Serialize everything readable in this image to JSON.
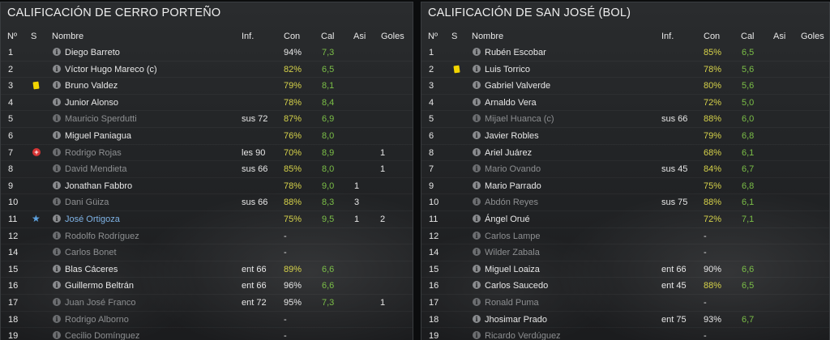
{
  "left": {
    "title": "CALIFICACIÓN DE CERRO PORTEÑO",
    "headers": {
      "num": "Nº",
      "s": "S",
      "name": "Nombre",
      "inf": "Inf.",
      "con": "Con",
      "cal": "Cal",
      "asi": "Asi",
      "goles": "Goles"
    },
    "rows": [
      {
        "num": "1",
        "status": "",
        "name": "Diego Barreto",
        "dim": false,
        "inf": "",
        "con": "94%",
        "cal": "7,3",
        "asi": "",
        "goles": "",
        "con_color": "white"
      },
      {
        "num": "2",
        "status": "",
        "name": "Víctor Hugo Mareco (c)",
        "dim": false,
        "inf": "",
        "con": "82%",
        "cal": "6,5",
        "asi": "",
        "goles": "",
        "con_color": "yellow"
      },
      {
        "num": "3",
        "status": "yellow-card",
        "name": "Bruno Valdez",
        "dim": false,
        "inf": "",
        "con": "79%",
        "cal": "8,1",
        "asi": "",
        "goles": "",
        "con_color": "yellow"
      },
      {
        "num": "4",
        "status": "",
        "name": "Junior Alonso",
        "dim": false,
        "inf": "",
        "con": "78%",
        "cal": "8,4",
        "asi": "",
        "goles": "",
        "con_color": "yellow"
      },
      {
        "num": "5",
        "status": "",
        "name": "Mauricio Sperdutti",
        "dim": true,
        "inf": "sus 72",
        "con": "87%",
        "cal": "6,9",
        "asi": "",
        "goles": "",
        "con_color": "yellow"
      },
      {
        "num": "6",
        "status": "",
        "name": "Miguel Paniagua",
        "dim": false,
        "inf": "",
        "con": "76%",
        "cal": "8,0",
        "asi": "",
        "goles": "",
        "con_color": "yellow"
      },
      {
        "num": "7",
        "status": "injury",
        "name": "Rodrigo Rojas",
        "dim": true,
        "inf": "les 90",
        "con": "70%",
        "cal": "8,9",
        "asi": "",
        "goles": "1",
        "con_color": "yellow"
      },
      {
        "num": "8",
        "status": "",
        "name": "David Mendieta",
        "dim": true,
        "inf": "sus 66",
        "con": "85%",
        "cal": "8,0",
        "asi": "",
        "goles": "1",
        "con_color": "yellow"
      },
      {
        "num": "9",
        "status": "",
        "name": "Jonathan Fabbro",
        "dim": false,
        "inf": "",
        "con": "78%",
        "cal": "9,0",
        "asi": "1",
        "goles": "",
        "con_color": "yellow"
      },
      {
        "num": "10",
        "status": "",
        "name": "Dani Güiza",
        "dim": true,
        "inf": "sus 66",
        "con": "88%",
        "cal": "8,3",
        "asi": "3",
        "goles": "",
        "con_color": "yellow"
      },
      {
        "num": "11",
        "status": "star",
        "name": "José Ortigoza",
        "dim": false,
        "selected": true,
        "inf": "",
        "con": "75%",
        "cal": "9,5",
        "asi": "1",
        "goles": "2",
        "con_color": "yellow"
      },
      {
        "num": "12",
        "status": "",
        "name": "Rodolfo Rodríguez",
        "dim": true,
        "inf": "",
        "con": "-",
        "cal": "",
        "asi": "",
        "goles": "",
        "con_color": "white"
      },
      {
        "num": "14",
        "status": "",
        "name": "Carlos Bonet",
        "dim": true,
        "inf": "",
        "con": "-",
        "cal": "",
        "asi": "",
        "goles": "",
        "con_color": "white"
      },
      {
        "num": "15",
        "status": "",
        "name": "Blas Cáceres",
        "dim": false,
        "inf": "ent 66",
        "con": "89%",
        "cal": "6,6",
        "asi": "",
        "goles": "",
        "con_color": "yellow"
      },
      {
        "num": "16",
        "status": "",
        "name": "Guillermo Beltrán",
        "dim": false,
        "inf": "ent 66",
        "con": "96%",
        "cal": "6,6",
        "asi": "",
        "goles": "",
        "con_color": "white"
      },
      {
        "num": "17",
        "status": "",
        "name": "Juan José Franco",
        "dim": true,
        "inf": "ent 72",
        "con": "95%",
        "cal": "7,3",
        "asi": "",
        "goles": "1",
        "con_color": "white"
      },
      {
        "num": "18",
        "status": "",
        "name": "Rodrigo Alborno",
        "dim": true,
        "inf": "",
        "con": "-",
        "cal": "",
        "asi": "",
        "goles": "",
        "con_color": "white"
      },
      {
        "num": "19",
        "status": "",
        "name": "Cecilio Domínguez",
        "dim": true,
        "inf": "",
        "con": "-",
        "cal": "",
        "asi": "",
        "goles": "",
        "con_color": "white"
      }
    ]
  },
  "right": {
    "title": "CALIFICACIÓN DE SAN JOSÉ (BOL)",
    "headers": {
      "num": "Nº",
      "s": "S",
      "name": "Nombre",
      "inf": "Inf.",
      "con": "Con",
      "cal": "Cal",
      "asi": "Asi",
      "goles": "Goles"
    },
    "rows": [
      {
        "num": "1",
        "status": "",
        "name": "Rubén Escobar",
        "dim": false,
        "inf": "",
        "con": "85%",
        "cal": "6,5",
        "asi": "",
        "goles": "",
        "con_color": "yellow"
      },
      {
        "num": "2",
        "status": "yellow-card",
        "name": "Luis Torrico",
        "dim": false,
        "inf": "",
        "con": "78%",
        "cal": "5,6",
        "asi": "",
        "goles": "",
        "con_color": "yellow"
      },
      {
        "num": "3",
        "status": "",
        "name": "Gabriel Valverde",
        "dim": false,
        "inf": "",
        "con": "80%",
        "cal": "5,6",
        "asi": "",
        "goles": "",
        "con_color": "yellow"
      },
      {
        "num": "4",
        "status": "",
        "name": "Arnaldo Vera",
        "dim": false,
        "inf": "",
        "con": "72%",
        "cal": "5,0",
        "asi": "",
        "goles": "",
        "con_color": "yellow"
      },
      {
        "num": "5",
        "status": "",
        "name": "Mijael Huanca (c)",
        "dim": true,
        "inf": "sus 66",
        "con": "88%",
        "cal": "6,0",
        "asi": "",
        "goles": "",
        "con_color": "yellow"
      },
      {
        "num": "6",
        "status": "",
        "name": "Javier Robles",
        "dim": false,
        "inf": "",
        "con": "79%",
        "cal": "6,8",
        "asi": "",
        "goles": "",
        "con_color": "yellow"
      },
      {
        "num": "8",
        "status": "",
        "name": "Ariel Juárez",
        "dim": false,
        "inf": "",
        "con": "68%",
        "cal": "6,1",
        "asi": "",
        "goles": "",
        "con_color": "yellow"
      },
      {
        "num": "7",
        "status": "",
        "name": "Mario Ovando",
        "dim": true,
        "inf": "sus 45",
        "con": "84%",
        "cal": "6,7",
        "asi": "",
        "goles": "",
        "con_color": "yellow"
      },
      {
        "num": "9",
        "status": "",
        "name": "Mario Parrado",
        "dim": false,
        "inf": "",
        "con": "75%",
        "cal": "6,8",
        "asi": "",
        "goles": "",
        "con_color": "yellow"
      },
      {
        "num": "10",
        "status": "",
        "name": "Abdón Reyes",
        "dim": true,
        "inf": "sus 75",
        "con": "88%",
        "cal": "6,1",
        "asi": "",
        "goles": "",
        "con_color": "yellow"
      },
      {
        "num": "11",
        "status": "",
        "name": "Ángel Orué",
        "dim": false,
        "inf": "",
        "con": "72%",
        "cal": "7,1",
        "asi": "",
        "goles": "",
        "con_color": "yellow"
      },
      {
        "num": "12",
        "status": "",
        "name": "Carlos Lampe",
        "dim": true,
        "inf": "",
        "con": "-",
        "cal": "",
        "asi": "",
        "goles": "",
        "con_color": "white"
      },
      {
        "num": "14",
        "status": "",
        "name": "Wilder Zabala",
        "dim": true,
        "inf": "",
        "con": "-",
        "cal": "",
        "asi": "",
        "goles": "",
        "con_color": "white"
      },
      {
        "num": "15",
        "status": "",
        "name": "Miguel Loaiza",
        "dim": false,
        "inf": "ent 66",
        "con": "90%",
        "cal": "6,6",
        "asi": "",
        "goles": "",
        "con_color": "white"
      },
      {
        "num": "16",
        "status": "",
        "name": "Carlos Saucedo",
        "dim": false,
        "inf": "ent 45",
        "con": "88%",
        "cal": "6,5",
        "asi": "",
        "goles": "",
        "con_color": "yellow"
      },
      {
        "num": "17",
        "status": "",
        "name": "Ronald Puma",
        "dim": true,
        "inf": "",
        "con": "-",
        "cal": "",
        "asi": "",
        "goles": "",
        "con_color": "white"
      },
      {
        "num": "18",
        "status": "",
        "name": "Jhosimar Prado",
        "dim": false,
        "inf": "ent 75",
        "con": "93%",
        "cal": "6,7",
        "asi": "",
        "goles": "",
        "con_color": "white"
      },
      {
        "num": "19",
        "status": "",
        "name": "Ricardo Verdúguez",
        "dim": true,
        "inf": "",
        "con": "-",
        "cal": "",
        "asi": "",
        "goles": "",
        "con_color": "white"
      }
    ]
  },
  "colors": {
    "con_yellow": "#d7d34a",
    "cal_green": "#7bbf47",
    "selected_name": "#7fb3e6",
    "yellow_card": "#f2d500",
    "injury": "#d63434"
  },
  "icons": {
    "info": "info-icon",
    "yellow_card": "yellow-card-icon",
    "injury": "injury-icon",
    "star": "star-icon"
  }
}
